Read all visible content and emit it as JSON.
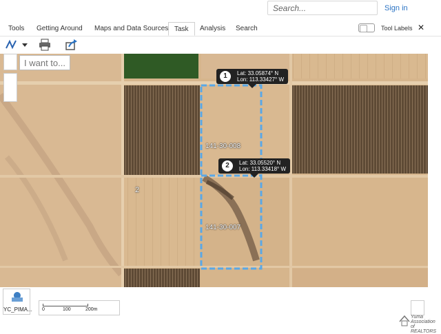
{
  "search": {
    "placeholder": "Search..."
  },
  "auth": {
    "signin_label": "Sign in"
  },
  "menu": {
    "tabs": [
      {
        "label": "Tools"
      },
      {
        "label": "Getting Around"
      },
      {
        "label": "Maps and Data Sources"
      },
      {
        "label": "Task"
      },
      {
        "label": "Analysis"
      },
      {
        "label": "Search"
      }
    ],
    "active_tab": "Task",
    "tool_labels": "Tool Labels",
    "close_glyph": "✕"
  },
  "toolbar": {
    "icons": [
      "draw-line-icon",
      "dropdown-caret-icon",
      "printer-icon",
      "share-icon"
    ]
  },
  "map": {
    "iwant_placeholder": "I want to...",
    "parcels": [
      {
        "id": "141-30-008"
      },
      {
        "id": "141-30-007"
      }
    ],
    "markers": [
      {
        "num": "1",
        "lat": "Lat: 33.05874° N",
        "lon": "Lon: 113.33427° W"
      },
      {
        "num": "2",
        "lat": "Lat: 33.05520° N",
        "lon": "Lon: 113.33418° W"
      }
    ],
    "section_number": "2",
    "selection_color": "#5aa8e6"
  },
  "bottom": {
    "layer_label": "YC_PIMA...",
    "scale": {
      "t0": "0",
      "t1": "100",
      "t2": "200m"
    },
    "logo_text_1": "Yuma",
    "logo_text_2": "Association",
    "logo_text_3": "of REALTORS"
  },
  "colors": {
    "accent": "#2a73c4",
    "field_dark": "#5a4632",
    "desert": "#d8b78f",
    "green_field": "#2f5a25"
  }
}
